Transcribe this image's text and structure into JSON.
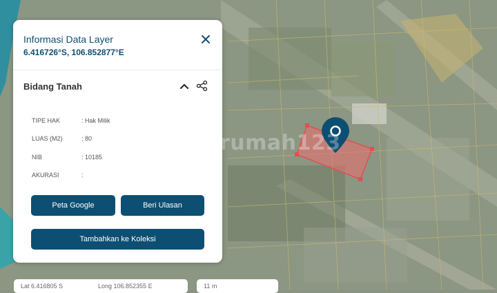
{
  "map": {
    "watermark": "rumah123",
    "colors": {
      "parcel_fill": "#e8707080",
      "parcel_stroke": "#e05050",
      "marker": "#0d4f73"
    }
  },
  "panel": {
    "title": "Informasi Data Layer",
    "coords": "6.416726°S, 106.852877°E",
    "close_icon": "close-icon",
    "section_title": "Bidang Tanah",
    "attributes": [
      {
        "key": "TIPE HAK",
        "value": ": Hak Milik"
      },
      {
        "key": "LUAS (M2)",
        "value": ": 80"
      },
      {
        "key": "NIB",
        "value": ": 10185"
      },
      {
        "key": "AKURASI",
        "value": ":"
      }
    ],
    "buttons": {
      "google": "Peta Google",
      "review": "Beri Ulasan",
      "collection": "Tambahkan ke Koleksi"
    }
  },
  "footer": {
    "lat": "Lat 6.416805 S",
    "long": "Long 106.852355 E",
    "zoom": "11 m"
  }
}
